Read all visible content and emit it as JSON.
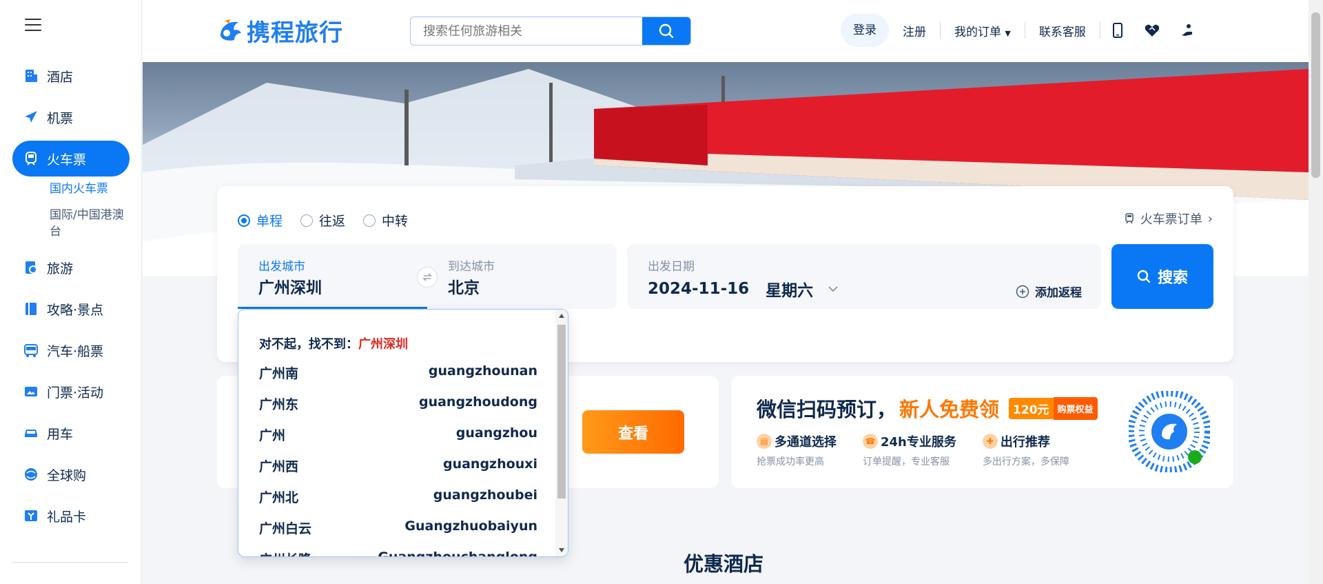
{
  "sidebar": {
    "items": [
      {
        "label": "酒店",
        "icon": "hotel-icon",
        "active": false
      },
      {
        "label": "机票",
        "icon": "plane-icon",
        "active": false
      },
      {
        "label": "火车票",
        "icon": "train-icon",
        "active": true
      },
      {
        "label": "旅游",
        "icon": "travel-icon",
        "active": false
      },
      {
        "label": "攻略·景点",
        "icon": "guide-icon",
        "active": false
      },
      {
        "label": "汽车·船票",
        "icon": "bus-icon",
        "active": false
      },
      {
        "label": "门票·活动",
        "icon": "ticket-icon",
        "active": false
      },
      {
        "label": "用车",
        "icon": "car-icon",
        "active": false
      },
      {
        "label": "全球购",
        "icon": "globe-shop-icon",
        "active": false
      },
      {
        "label": "礼品卡",
        "icon": "giftcard-icon",
        "active": false
      }
    ],
    "subitems": [
      {
        "label": "国内火车票",
        "active": true
      },
      {
        "label": "国际/中国港澳台",
        "active": false
      }
    ]
  },
  "header": {
    "logo_text": "携程旅行",
    "search_placeholder": "搜索任何旅游相关",
    "login": "登录",
    "register": "注册",
    "orders": "我的订单",
    "service": "联系客服"
  },
  "search_card": {
    "trip_types": [
      "单程",
      "往返",
      "中转"
    ],
    "selected_trip": "单程",
    "orders_link": "火车票订单",
    "from_label": "出发城市",
    "from_value": "广州深圳",
    "to_label": "到达城市",
    "to_value": "北京",
    "date_label": "出发日期",
    "date_value": "2024-11-16",
    "weekday": "星期六",
    "add_return": "添加返程",
    "search_button": "搜索"
  },
  "dropdown": {
    "message_prefix": "对不起，找不到：",
    "message_query": "广州深圳",
    "items": [
      {
        "name": "广州南",
        "pinyin": "guangzhounan"
      },
      {
        "name": "广州东",
        "pinyin": "guangzhoudong"
      },
      {
        "name": "广州",
        "pinyin": "guangzhou"
      },
      {
        "name": "广州西",
        "pinyin": "guangzhouxi"
      },
      {
        "name": "广州北",
        "pinyin": "guangzhoubei"
      },
      {
        "name": "广州白云",
        "pinyin": "Guangzhuobaiyun"
      },
      {
        "name": "广州长隆",
        "pinyin": "Guangzhouchanglong"
      }
    ]
  },
  "promo_left": {
    "button": "查看"
  },
  "promo_right": {
    "title": "微信扫码预订，",
    "highlight": "新人免费领",
    "amount": "120元",
    "tag": "购票权益",
    "features": [
      {
        "title": "多通道选择",
        "sub": "抢票成功率更高"
      },
      {
        "title": "24h专业服务",
        "sub": "订单提醒，专业客服"
      },
      {
        "title": "出行推荐",
        "sub": "多出行方案，多保障"
      }
    ]
  },
  "section_title": "优惠酒店",
  "colors": {
    "accent": "#0a78f5",
    "orange": "#ff7700",
    "error": "#e6231d"
  }
}
